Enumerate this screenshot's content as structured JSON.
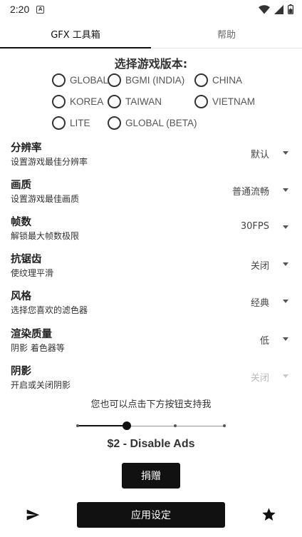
{
  "status_bar": {
    "time": "2:20",
    "badge": "A",
    "icons": [
      "wifi-icon",
      "signal-icon",
      "battery-icon"
    ]
  },
  "tabs": [
    {
      "label": "GFX 工具箱",
      "active": true
    },
    {
      "label": "帮助",
      "active": false
    }
  ],
  "version_section": {
    "title": "选择游戏版本:",
    "options": [
      {
        "label": "GLOBAL",
        "selected": false
      },
      {
        "label": "BGMI (INDIA)",
        "selected": false
      },
      {
        "label": "CHINA",
        "selected": false
      },
      {
        "label": "KOREA",
        "selected": false
      },
      {
        "label": "TAIWAN",
        "selected": false
      },
      {
        "label": "VIETNAM",
        "selected": false
      },
      {
        "label": "LITE",
        "selected": false
      },
      {
        "label": "GLOBAL (BETA)",
        "selected": false
      }
    ]
  },
  "settings": [
    {
      "label": "分辨率",
      "description": "设置游戏最佳分辨率",
      "value": "默认",
      "enabled": true
    },
    {
      "label": "画质",
      "description": "设置游戏最佳画质",
      "value": "普通流畅",
      "enabled": true
    },
    {
      "label": "帧数",
      "description": "解锁最大帧数极限",
      "value": "30FPS",
      "enabled": true
    },
    {
      "label": "抗锯齿",
      "description": "使纹理平滑",
      "value": "关闭",
      "enabled": true
    },
    {
      "label": "风格",
      "description": "选择您喜欢的滤色器",
      "value": "经典",
      "enabled": true
    },
    {
      "label": "渲染质量",
      "description": "阴影 着色器等",
      "value": "低",
      "enabled": true
    },
    {
      "label": "阴影",
      "description": "开启或关闭阴影",
      "value": "关闭",
      "enabled": false
    }
  ],
  "support": {
    "text": "您也可以点击下方按钮支持我",
    "slider_steps": 4,
    "slider_selected_step": 1,
    "price_label": "$2 - Disable Ads",
    "donate_label": "捐赠"
  },
  "bottom_bar": {
    "apply_label": "应用设定",
    "left_icon": "send-icon",
    "right_icon": "star-icon"
  },
  "colors": {
    "accent": "#111111",
    "disabled": "#bbbbbb"
  }
}
